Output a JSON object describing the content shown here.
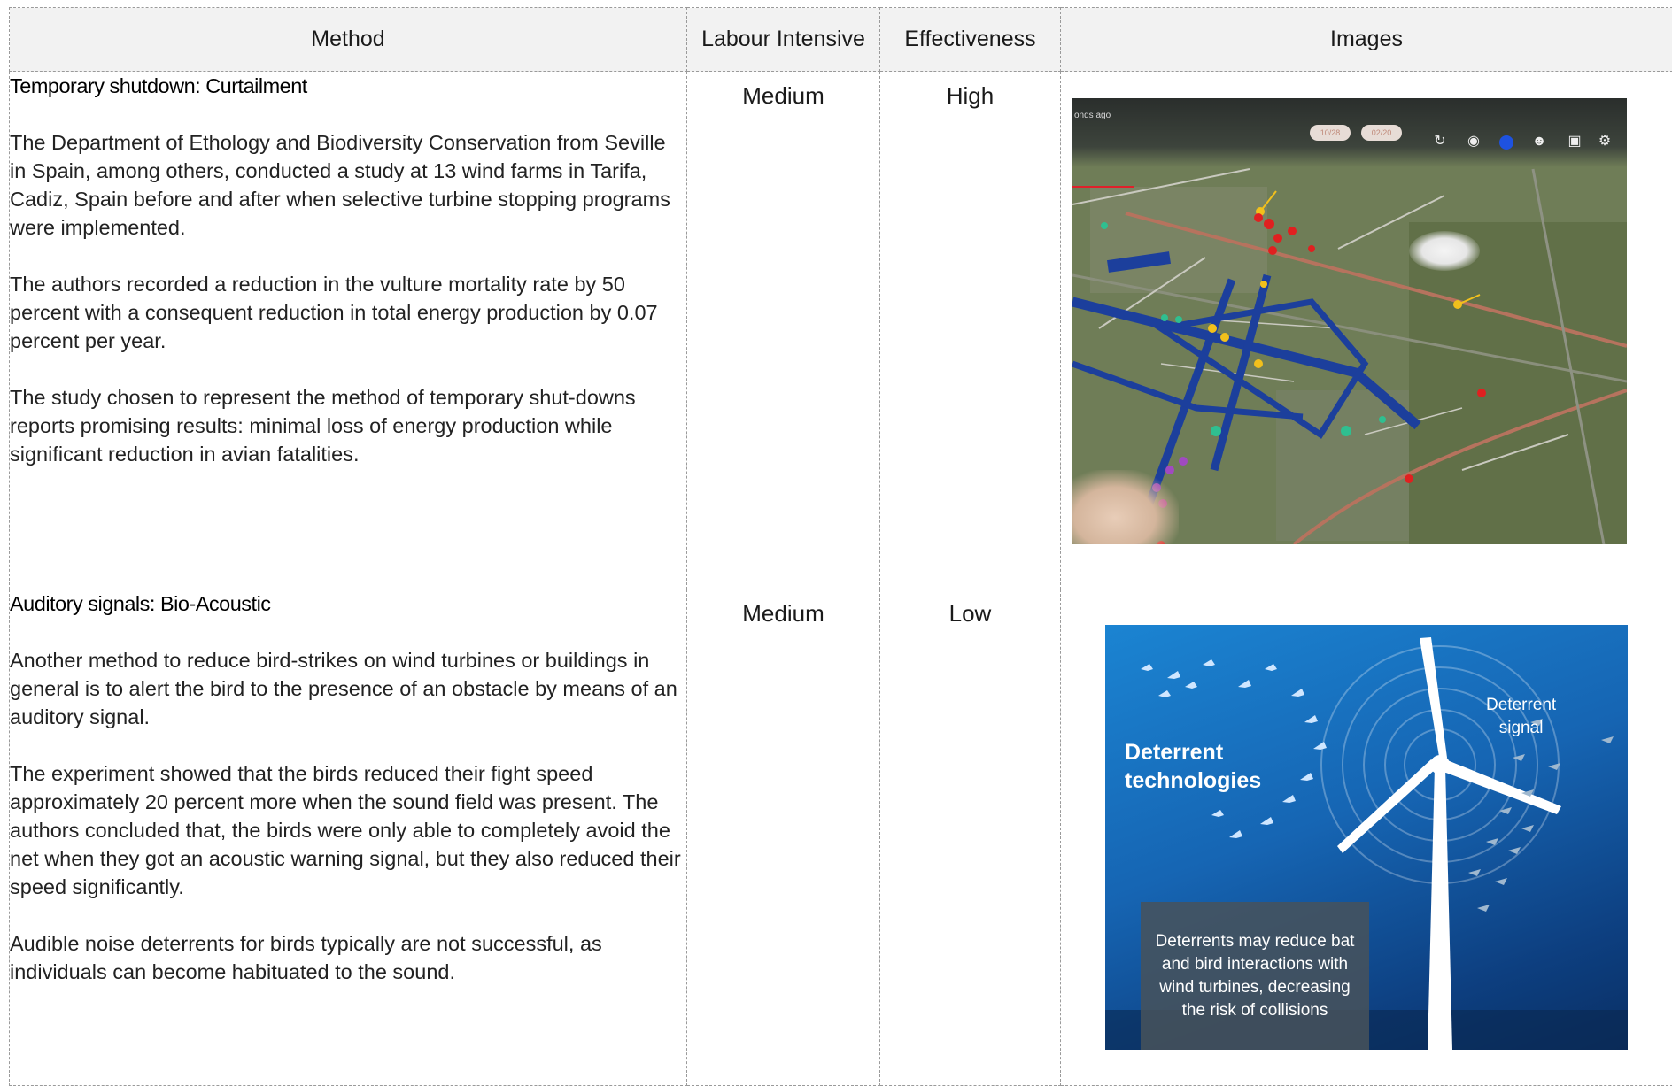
{
  "headers": {
    "method": "Method",
    "labour": "Labour Intensive",
    "effectiveness": "Effectiveness",
    "images": "Images"
  },
  "rows": [
    {
      "title": "Temporary shutdown: Curtailment",
      "paragraphs": [
        "The Department of Ethology and Biodiversity Conservation from Seville in Spain, among others, conducted a study at 13 wind farms in Tarifa, Cadiz, Spain before and after when selective turbine stopping programs were implemented.",
        "The authors recorded a reduction in the vulture mortality rate by 50 percent with a consequent reduction in total energy production by 0.07 percent per year.",
        "The study chosen to represent the method of temporary shut-downs reports promising results: minimal loss of energy production while significant reduction in avian fatalities."
      ],
      "labour": "Medium",
      "effectiveness": "High",
      "image": {
        "ago_text": "onds ago",
        "date_from": "10/28",
        "date_to": "02/20"
      }
    },
    {
      "title": "Auditory signals: Bio-Acoustic",
      "paragraphs": [
        "Another method to reduce bird-strikes on wind turbines or buildings in general is to alert the bird to the presence of an obstacle by means of an auditory signal.",
        "The experiment showed that the birds reduced their fight speed approximately 20 percent more when the sound field was present. The authors concluded that, the birds were only able to completely avoid the net when they got an acoustic warning signal, but they also reduced their speed significantly.",
        "Audible noise deterrents for birds typically are not successful, as individuals can become habituated to the sound."
      ],
      "labour": "Medium",
      "effectiveness": "Low",
      "image": {
        "title_line1": "Deterrent",
        "title_line2": "technologies",
        "signal_line1": "Deterrent",
        "signal_line2": "signal",
        "caption": "Deterrents may reduce bat and bird interactions with wind turbines, decreasing the risk of collisions"
      }
    }
  ]
}
